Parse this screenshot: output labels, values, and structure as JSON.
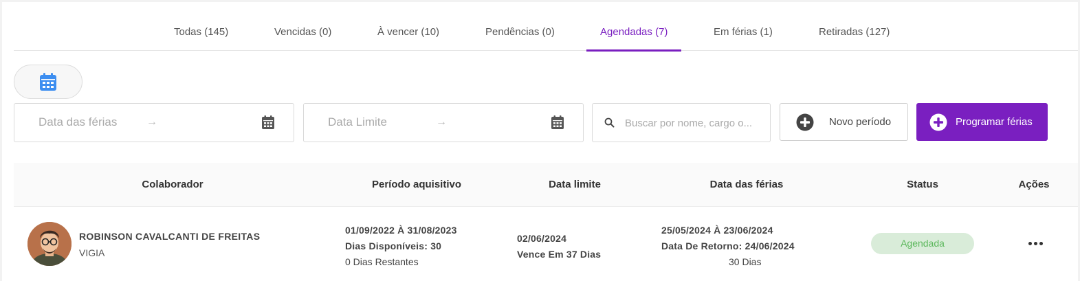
{
  "tabs": [
    {
      "label": "Todas (145)"
    },
    {
      "label": "Vencidas (0)"
    },
    {
      "label": "À vencer (10)"
    },
    {
      "label": "Pendências (0)"
    },
    {
      "label": "Agendadas (7)",
      "active": true
    },
    {
      "label": "Em férias (1)"
    },
    {
      "label": "Retiradas (127)"
    }
  ],
  "filters": {
    "vacation_date_placeholder": "Data das férias",
    "limit_date_placeholder": "Data Limite",
    "range_separator": "→",
    "search_placeholder": "Buscar por nome, cargo o...",
    "new_period_label": "Novo período",
    "schedule_label": "Programar férias"
  },
  "table": {
    "headers": {
      "employee": "Colaborador",
      "acquisition_period": "Período aquisitivo",
      "limit_date": "Data limite",
      "vacation_date": "Data das férias",
      "status": "Status",
      "actions": "Ações"
    },
    "rows": [
      {
        "name": "ROBINSON CAVALCANTI DE FREITAS",
        "role": "VIGIA",
        "period": "01/09/2022 À 31/08/2023",
        "available_days": "Dias Disponíveis: 30",
        "remaining_days": "0 Dias Restantes",
        "limit_date": "02/06/2024",
        "expires_in": "Vence Em 37 Dias",
        "vacation_range": "25/05/2024 À 23/06/2024",
        "return_date": "Data De Retorno: 24/06/2024",
        "vacation_days": "30 Dias",
        "status": "Agendada"
      }
    ]
  },
  "colors": {
    "accent": "#7a1fc0",
    "status_scheduled_bg": "#d9ecd9",
    "status_scheduled_text": "#5cb85c",
    "calendar_icon": "#3d8ef0"
  }
}
